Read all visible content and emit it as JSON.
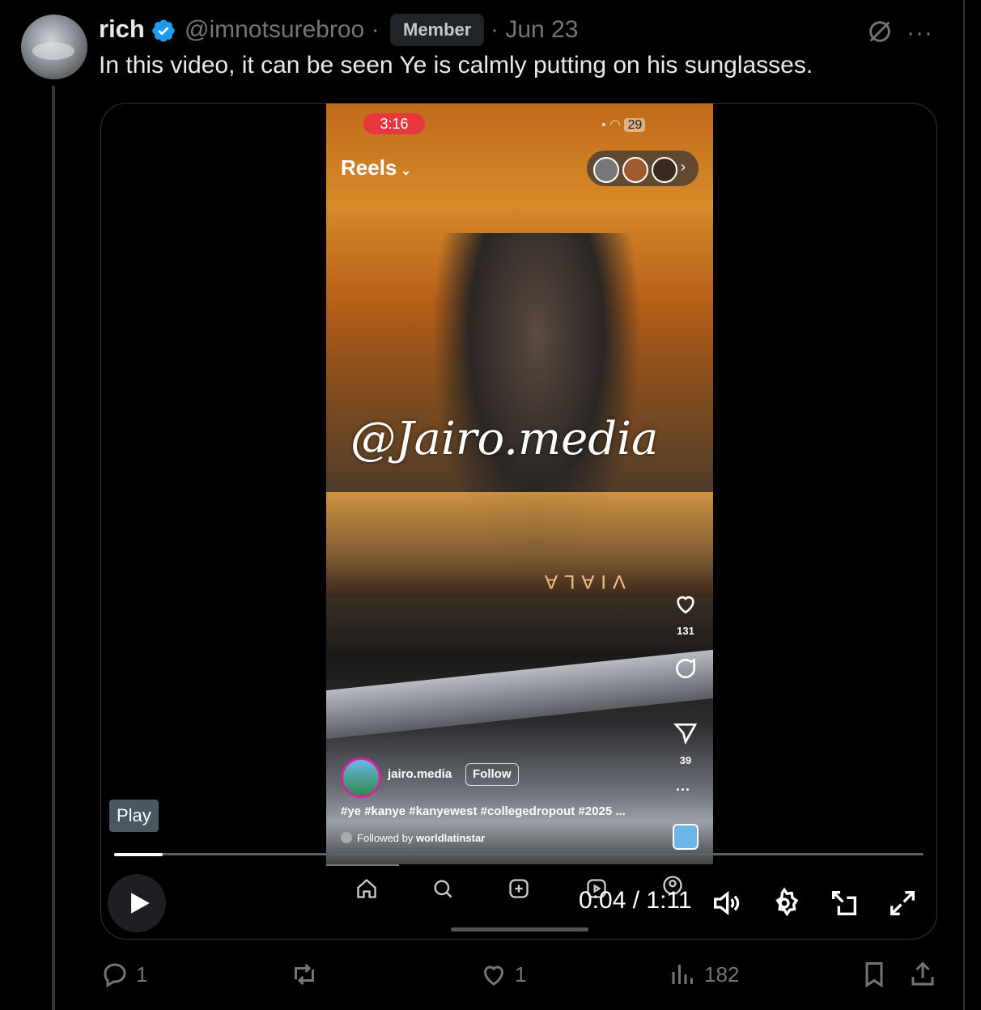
{
  "author": {
    "name": "rich",
    "handle": "@imnotsurebroo",
    "separator": "·",
    "badge": "Member",
    "date": "· Jun 23",
    "verified_color": "#1d9bf0"
  },
  "tweet": {
    "text": "In this video, it can be seen Ye is calmly putting on his sunglasses."
  },
  "video": {
    "play_tooltip": "Play",
    "time_display": "0:04 / 1:11",
    "progress": 0.06,
    "embedded_reel": {
      "status_time": "3:16",
      "battery": "29",
      "header": "Reels",
      "watermark": "@Jairo.media",
      "likes": "131",
      "shares": "39",
      "username": "jairo.media",
      "follow_label": "Follow",
      "caption": "#ye #kanye #kanyewest #collegedropout #2025 ...",
      "followed_by_prefix": "Followed by",
      "followed_by_user": "worldlatinstar",
      "reflected_sign": "VIALA"
    }
  },
  "actions": {
    "replies": "1",
    "reposts": "",
    "likes": "1",
    "views": "182"
  }
}
